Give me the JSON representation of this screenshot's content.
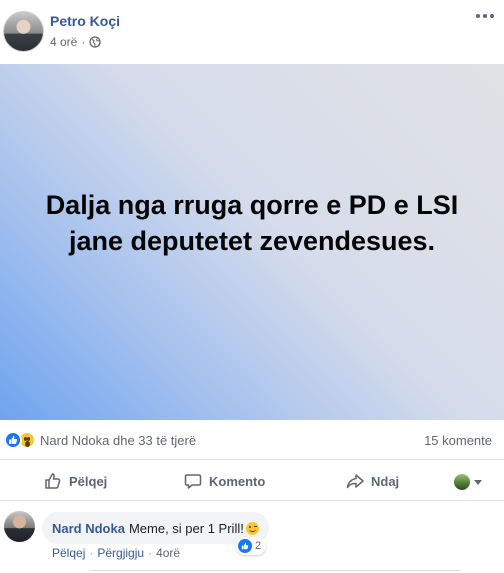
{
  "post": {
    "author": "Petro Koçi",
    "time": "4 orë",
    "separator": "·",
    "privacy_icon": "globe-icon",
    "more_icon": "ellipsis-icon"
  },
  "banner": {
    "text": "Dalja nga rruga qorre e PD e LSI jane deputetet zevendesues.",
    "gradient_colors": [
      "#6fa4ee",
      "#e1e2e6"
    ]
  },
  "stats": {
    "reaction_icons": [
      "like-icon",
      "wow-icon"
    ],
    "reactors": "Nard Ndoka dhe 33 të tjerë",
    "comments": "15 komente"
  },
  "actions": {
    "like": "Pëlqej",
    "comment": "Komento",
    "share": "Ndaj"
  },
  "comment": {
    "author": "Nard Ndoka",
    "text": "Meme, si per 1 Prill!",
    "emoji": "wink-emoji",
    "like_count": "2",
    "reply_like": "Pëlqej",
    "reply": "Përgjigju",
    "time": "4orë",
    "separator": "·"
  },
  "colors": {
    "link": "#385898",
    "like_blue": "#1877f2",
    "muted": "#606770"
  }
}
